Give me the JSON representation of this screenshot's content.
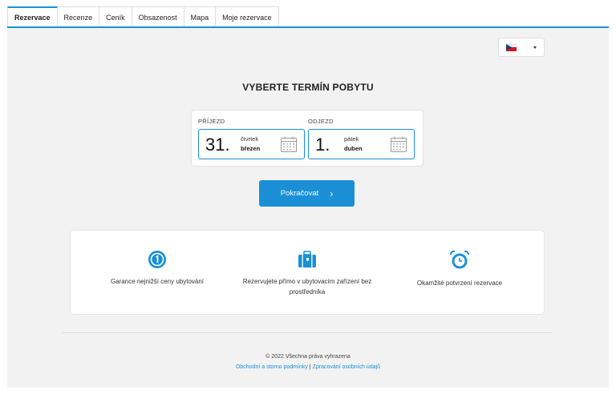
{
  "tabs": [
    {
      "label": "Rezervace",
      "active": true
    },
    {
      "label": "Recenze"
    },
    {
      "label": "Ceník"
    },
    {
      "label": "Obsazenost"
    },
    {
      "label": "Mapa"
    },
    {
      "label": "Moje rezervace"
    }
  ],
  "language": {
    "selected_flag": "czech-flag-icon"
  },
  "heading": "VYBERTE TERMÍN POBYTU",
  "arrival": {
    "label": "PŘÍJEZD",
    "day_number": "31.",
    "weekday": "čtvrtek",
    "month": "březen"
  },
  "departure": {
    "label": "ODJEZD",
    "day_number": "1.",
    "weekday": "pátek",
    "month": "duben"
  },
  "continue_button": {
    "label": "Pokračovat",
    "icon": "chevron-right-icon"
  },
  "features": [
    {
      "icon": "badge-one-icon",
      "text": "Garance nejnižší ceny ubytování"
    },
    {
      "icon": "luggage-icon",
      "text": "Rezervujete přímo v ubytovacím zařízení bez prostředníka"
    },
    {
      "icon": "alarm-clock-icon",
      "text": "Okamžité potvrzení rezervace"
    }
  ],
  "footer": {
    "copyright": "© 2022 Všechna práva vyhrazena",
    "link_terms": "Obchodní a storno podmínky",
    "separator": "|",
    "link_privacy": "Zpracování osobních údajů"
  },
  "colors": {
    "accent": "#1a8fd6",
    "panel_bg": "#f2f2f2"
  }
}
